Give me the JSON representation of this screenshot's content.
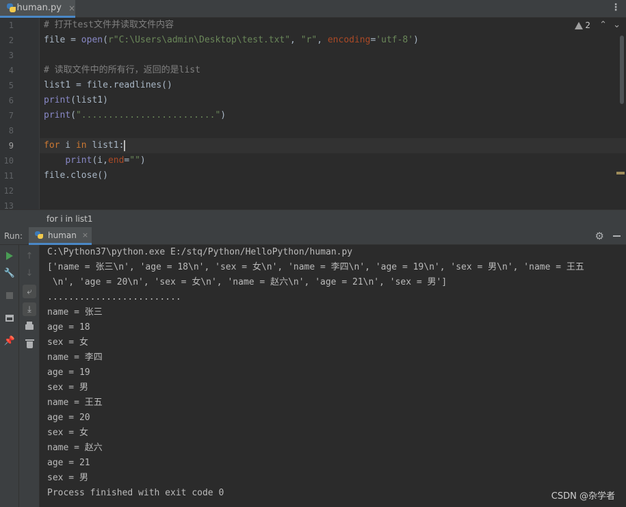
{
  "tab": {
    "filename": "human.py",
    "close": "×",
    "menu": "⋮"
  },
  "editor": {
    "warning_count": "2",
    "line_numbers": [
      "1",
      "2",
      "3",
      "4",
      "5",
      "6",
      "7",
      "8",
      "9",
      "10",
      "11",
      "12",
      "13"
    ],
    "active_line": "9",
    "code": {
      "l1_comment": "# 打开test文件并读取文件内容",
      "l2_var": "file = ",
      "l2_fn": "open",
      "l2_p1": "(",
      "l2_str1": "r\"C:\\Users\\admin\\Desktop\\test.txt\"",
      "l2_comma1": ", ",
      "l2_str2": "\"r\"",
      "l2_comma2": ", ",
      "l2_param": "encoding",
      "l2_eq": "=",
      "l2_str3": "'utf-8'",
      "l2_p2": ")",
      "l4_comment": "# 读取文件中的所有行，返回的是list",
      "l5": "list1 = file.readlines()",
      "l6_fn": "print",
      "l6_rest": "(list1)",
      "l7_fn": "print",
      "l7_p1": "(",
      "l7_str": "\".........................\"",
      "l7_p2": ")",
      "l9_for": "for",
      "l9_i": " i ",
      "l9_in": "in",
      "l9_rest": " list1:",
      "l10_indent": "    ",
      "l10_fn": "print",
      "l10_p1": "(i,",
      "l10_param": "end",
      "l10_eq": "=",
      "l10_str": "\"\"",
      "l10_p2": ")",
      "l11": "file.close()"
    }
  },
  "breadcrumb": {
    "text": "for i in list1"
  },
  "run": {
    "label": "Run:",
    "tab_name": "human",
    "close": "×"
  },
  "console": {
    "lines": [
      "C:\\Python37\\python.exe E:/stq/Python/HelloPython/human.py",
      "['name = 张三\\n', 'age = 18\\n', 'sex = 女\\n', 'name = 李四\\n', 'age = 19\\n', 'sex = 男\\n', 'name = 王五",
      " \\n', 'age = 20\\n', 'sex = 女\\n', 'name = 赵六\\n', 'age = 21\\n', 'sex = 男']",
      ".........................",
      "name = 张三",
      "age = 18",
      "sex = 女",
      "name = 李四",
      "age = 19",
      "sex = 男",
      "name = 王五",
      "age = 20",
      "sex = 女",
      "name = 赵六",
      "age = 21",
      "sex = 男",
      "Process finished with exit code 0"
    ]
  },
  "watermark": "CSDN @杂学者",
  "colors": {
    "keyword": "#cc7832",
    "string": "#6a8759",
    "comment": "#808080",
    "builtin": "#8888c6",
    "param": "#aa4926",
    "run_green": "#499c54",
    "accent": "#4a88c7"
  }
}
